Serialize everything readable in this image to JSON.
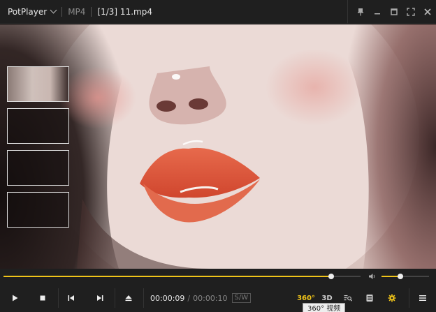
{
  "titlebar": {
    "app_name": "PotPlayer",
    "format": "MP4",
    "playlist_position": "[1/3] 11.mp4"
  },
  "seek": {
    "progress": 0.917
  },
  "volume": {
    "level": 0.4
  },
  "time": {
    "current": "00:00:09",
    "separator": "/",
    "duration": "00:00:10",
    "sw_badge": "S/W"
  },
  "buttons": {
    "vr_360_label": "360°",
    "three_d_label": "3D"
  },
  "tooltip": {
    "text": "360° 视频"
  },
  "icons": [
    "pin-icon",
    "minimize-icon",
    "maximize-icon",
    "fullscreen-icon",
    "close-icon",
    "volume-icon",
    "play-icon",
    "stop-icon",
    "previous-icon",
    "next-icon",
    "eject-icon",
    "playlist-search-icon",
    "chapter-icon",
    "settings-icon",
    "menu-icon"
  ],
  "colors": {
    "accent": "#f0c419",
    "bar": "#1f1f1f"
  }
}
